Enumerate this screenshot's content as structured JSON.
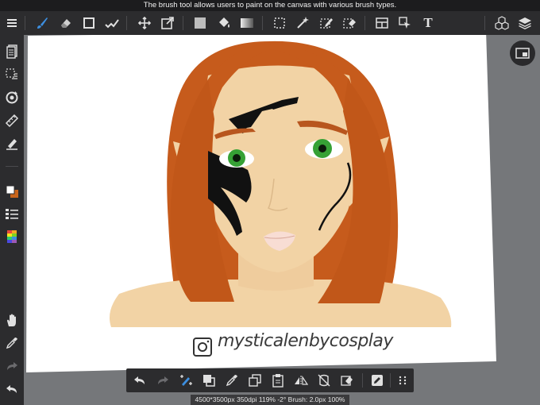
{
  "tooltip": "The brush tool allows users to paint on the canvas with various brush types.",
  "top_toolbar": {
    "tools": [
      {
        "id": "menu",
        "icon": "hamburger-menu-icon"
      },
      {
        "id": "brush",
        "icon": "brush-icon",
        "active": true
      },
      {
        "id": "eraser",
        "icon": "eraser-icon"
      },
      {
        "id": "shape",
        "icon": "square-shape-icon"
      },
      {
        "id": "smudge",
        "icon": "smudge-icon"
      },
      {
        "id": "move",
        "icon": "move-arrows-icon"
      },
      {
        "id": "transform",
        "icon": "transform-icon"
      },
      {
        "id": "fill-color",
        "icon": "fill-swatch-icon"
      },
      {
        "id": "bucket",
        "icon": "paint-bucket-icon"
      },
      {
        "id": "gradient",
        "icon": "gradient-icon"
      },
      {
        "id": "select",
        "icon": "rect-select-icon"
      },
      {
        "id": "magic-wand",
        "icon": "magic-wand-icon"
      },
      {
        "id": "select-pen",
        "icon": "select-pen-icon"
      },
      {
        "id": "select-eraser",
        "icon": "select-eraser-icon"
      },
      {
        "id": "frame-divider",
        "icon": "frame-divider-icon"
      },
      {
        "id": "operation",
        "icon": "operation-cursor-icon"
      },
      {
        "id": "text",
        "icon": "text-icon",
        "label": "T"
      },
      {
        "id": "materials",
        "icon": "materials-cubes-icon"
      },
      {
        "id": "layers",
        "icon": "layers-icon"
      }
    ]
  },
  "left_toolbar": {
    "tools": [
      {
        "id": "pages",
        "icon": "pages-icon"
      },
      {
        "id": "selection-layer",
        "icon": "selection-list-icon"
      },
      {
        "id": "rotate",
        "icon": "rotate-icon"
      },
      {
        "id": "ruler",
        "icon": "ruler-icon"
      },
      {
        "id": "snap-pen",
        "icon": "pen-snap-icon"
      },
      {
        "id": "color",
        "icon": "color-swatch-icon"
      },
      {
        "id": "brush-list",
        "icon": "brush-list-icon"
      },
      {
        "id": "palette",
        "icon": "color-palette-icon"
      },
      {
        "id": "hand",
        "icon": "hand-icon"
      },
      {
        "id": "eyedropper",
        "icon": "eyedropper-icon"
      },
      {
        "id": "redo",
        "icon": "redo-icon"
      },
      {
        "id": "undo",
        "icon": "undo-icon"
      }
    ]
  },
  "colors": {
    "toolbar_bg": "#2c2c2e",
    "accent": "#3d8fe0",
    "main_color": "#ffffff",
    "sub_color": "#c9651c",
    "canvas_bg": "#75777a",
    "hair": "#c65b1c",
    "skin": "#f2d3a5",
    "eye": "#36a135"
  },
  "canvas": {
    "signature": "mysticalenbycosplay"
  },
  "bottom_toolbar": {
    "tools": [
      {
        "id": "undo",
        "icon": "undo-icon"
      },
      {
        "id": "redo",
        "icon": "redo-icon"
      },
      {
        "id": "swap-color",
        "icon": "swap-color-icon"
      },
      {
        "id": "color-box",
        "icon": "color-box-icon"
      },
      {
        "id": "eyedropper",
        "icon": "eyedropper-icon"
      },
      {
        "id": "copy",
        "icon": "copy-icon"
      },
      {
        "id": "paste",
        "icon": "paste-icon"
      },
      {
        "id": "flip",
        "icon": "flip-horizontal-icon"
      },
      {
        "id": "rotate",
        "icon": "rotate-canvas-icon"
      },
      {
        "id": "clear",
        "icon": "clear-icon"
      },
      {
        "id": "edit",
        "icon": "edit-icon"
      },
      {
        "id": "more",
        "icon": "more-dots-icon"
      }
    ]
  },
  "status": "4500*3500px 350dpi 119% -2° Brush: 2.0px 100%"
}
